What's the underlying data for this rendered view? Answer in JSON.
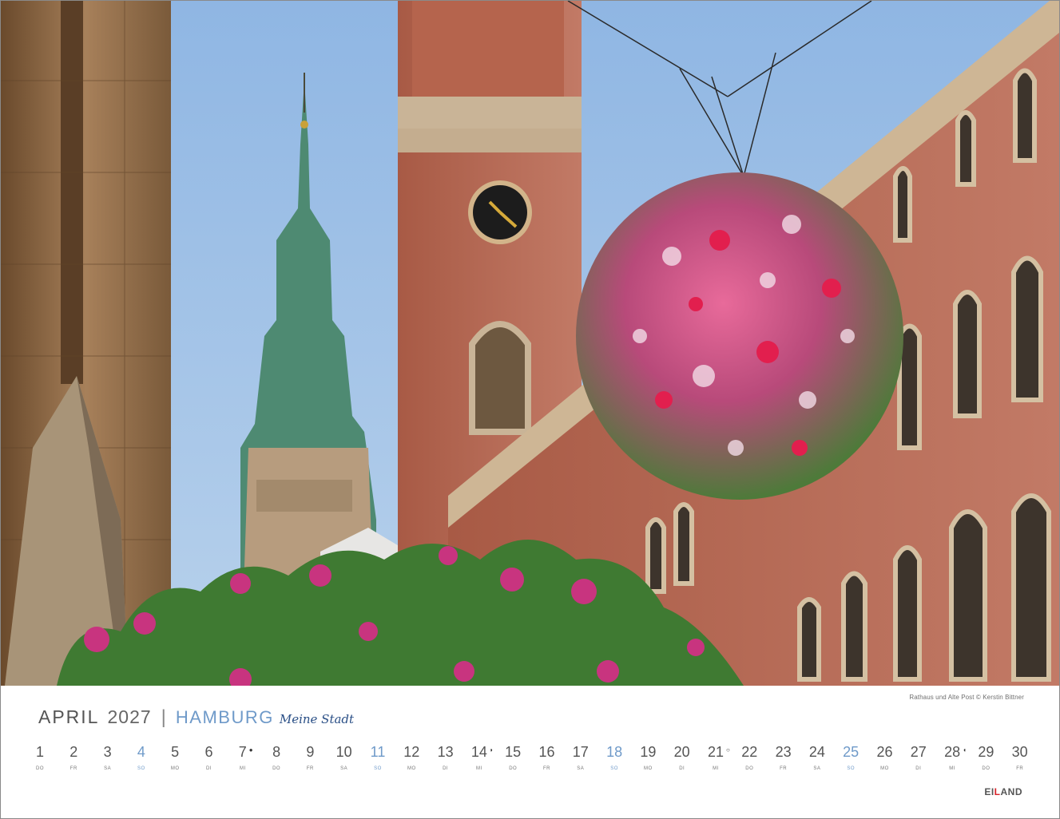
{
  "photo_caption": "Rathaus und Alte Post © Kerstin Bittner",
  "header": {
    "month": "APRIL",
    "year": "2027",
    "separator": "|",
    "city": "HAMBURG",
    "subtitle": "Meine Stadt"
  },
  "days": [
    {
      "num": "1",
      "dow": "DO"
    },
    {
      "num": "2",
      "dow": "FR"
    },
    {
      "num": "3",
      "dow": "SA"
    },
    {
      "num": "4",
      "dow": "SO",
      "sunday": true
    },
    {
      "num": "5",
      "dow": "MO"
    },
    {
      "num": "6",
      "dow": "DI"
    },
    {
      "num": "7",
      "dow": "MI",
      "moon": "●"
    },
    {
      "num": "8",
      "dow": "DO"
    },
    {
      "num": "9",
      "dow": "FR"
    },
    {
      "num": "10",
      "dow": "SA"
    },
    {
      "num": "11",
      "dow": "SO",
      "sunday": true
    },
    {
      "num": "12",
      "dow": "MO"
    },
    {
      "num": "13",
      "dow": "DI"
    },
    {
      "num": "14",
      "dow": "MI",
      "moon": "◗"
    },
    {
      "num": "15",
      "dow": "DO"
    },
    {
      "num": "16",
      "dow": "FR"
    },
    {
      "num": "17",
      "dow": "SA"
    },
    {
      "num": "18",
      "dow": "SO",
      "sunday": true
    },
    {
      "num": "19",
      "dow": "MO"
    },
    {
      "num": "20",
      "dow": "DI"
    },
    {
      "num": "21",
      "dow": "MI",
      "moon": "○"
    },
    {
      "num": "22",
      "dow": "DO"
    },
    {
      "num": "23",
      "dow": "FR"
    },
    {
      "num": "24",
      "dow": "SA"
    },
    {
      "num": "25",
      "dow": "SO",
      "sunday": true
    },
    {
      "num": "26",
      "dow": "MO"
    },
    {
      "num": "27",
      "dow": "DI"
    },
    {
      "num": "28",
      "dow": "MI",
      "moon": "◖"
    },
    {
      "num": "29",
      "dow": "DO"
    },
    {
      "num": "30",
      "dow": "FR"
    }
  ],
  "logo": {
    "pre": "EI",
    "accent": "L",
    "post": "AND"
  },
  "colors": {
    "sunday": "#6f9ac9",
    "subtitle": "#2a4f86",
    "logo_accent": "#d8232a"
  }
}
